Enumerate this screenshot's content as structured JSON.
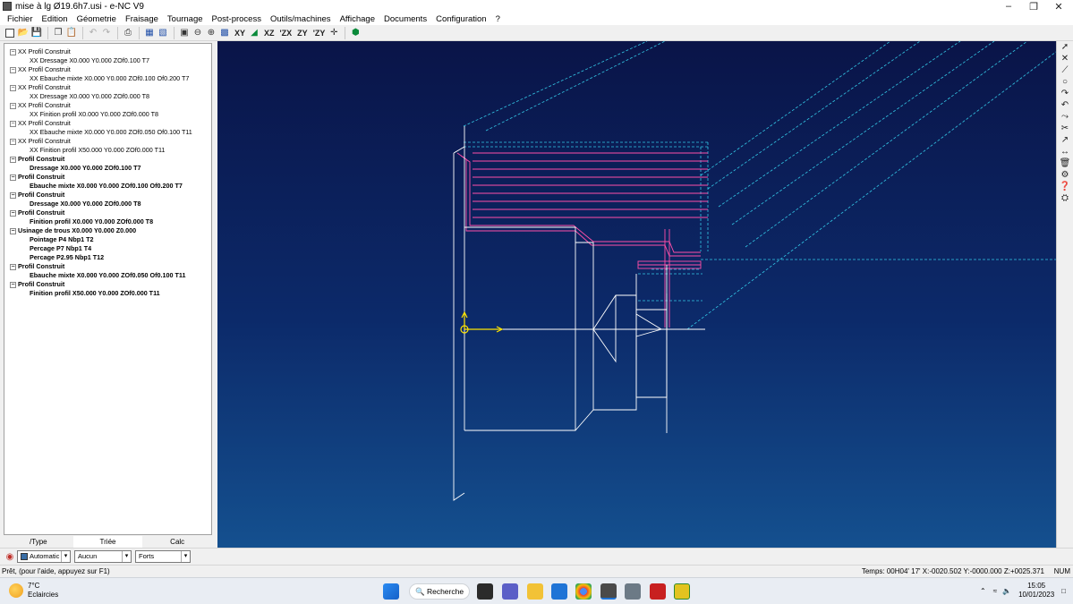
{
  "window": {
    "title": "mise à lg Ø19.6h7.usi - e-NC V9"
  },
  "menu": [
    "Fichier",
    "Edition",
    "Géometrie",
    "Fraisage",
    "Tournage",
    "Post-process",
    "Outils/machines",
    "Affichage",
    "Documents",
    "Configuration",
    "?"
  ],
  "toolbar": {
    "view_labels": [
      "XY",
      "XZ",
      "'ZX",
      "ZY",
      "'ZY"
    ]
  },
  "tree": [
    {
      "label": "XX Profil Construit",
      "level": 0,
      "bold": false
    },
    {
      "label": "XX Dressage X0.000 Y0.000 ZOf0.100 T7",
      "level": 1,
      "bold": false
    },
    {
      "label": "XX Profil Construit",
      "level": 0,
      "bold": false
    },
    {
      "label": "XX Ebauche mixte X0.000 Y0.000 ZOf0.100 Of0.200 T7",
      "level": 1,
      "bold": false
    },
    {
      "label": "XX Profil Construit",
      "level": 0,
      "bold": false
    },
    {
      "label": "XX Dressage X0.000 Y0.000 ZOf0.000 T8",
      "level": 1,
      "bold": false
    },
    {
      "label": "XX Profil Construit",
      "level": 0,
      "bold": false
    },
    {
      "label": "XX Finition profil X0.000 Y0.000 ZOf0.000 T8",
      "level": 1,
      "bold": false
    },
    {
      "label": "XX Profil Construit",
      "level": 0,
      "bold": false
    },
    {
      "label": "XX Ebauche mixte X0.000 Y0.000 ZOf0.050 Of0.100 T11",
      "level": 1,
      "bold": false
    },
    {
      "label": "XX Profil Construit",
      "level": 0,
      "bold": false
    },
    {
      "label": "XX Finition profil X50.000 Y0.000 ZOf0.000 T11",
      "level": 1,
      "bold": false
    },
    {
      "label": "Profil Construit",
      "level": 0,
      "bold": true
    },
    {
      "label": "Dressage X0.000 Y0.000 ZOf0.100 T7",
      "level": 1,
      "bold": true
    },
    {
      "label": "Profil Construit",
      "level": 0,
      "bold": true
    },
    {
      "label": "Ebauche mixte X0.000 Y0.000 ZOf0.100 Of0.200 T7",
      "level": 1,
      "bold": true
    },
    {
      "label": "Profil Construit",
      "level": 0,
      "bold": true
    },
    {
      "label": "Dressage X0.000 Y0.000 ZOf0.000 T8",
      "level": 1,
      "bold": true
    },
    {
      "label": "Profil Construit",
      "level": 0,
      "bold": true
    },
    {
      "label": "Finition profil X0.000 Y0.000 ZOf0.000 T8",
      "level": 1,
      "bold": true
    },
    {
      "label": "Usinage de trous X0.000 Y0.000 Z0.000",
      "level": 0,
      "bold": true
    },
    {
      "label": "Pointage P4 Nbp1 T2",
      "level": 1,
      "bold": true
    },
    {
      "label": "Percage P7 Nbp1 T4",
      "level": 1,
      "bold": true
    },
    {
      "label": "Percage P2.95 Nbp1 T12",
      "level": 1,
      "bold": true
    },
    {
      "label": "Profil Construit",
      "level": 0,
      "bold": true
    },
    {
      "label": "Ebauche mixte X0.000 Y0.000 ZOf0.050 Of0.100 T11",
      "level": 1,
      "bold": true
    },
    {
      "label": "Profil Construit",
      "level": 0,
      "bold": true
    },
    {
      "label": "Finition profil X50.000 Y0.000 ZOf0.000 T11",
      "level": 1,
      "bold": true
    }
  ],
  "tabs": [
    "/Type",
    "Triée",
    "Calc"
  ],
  "options": {
    "color_mode": "Automatic",
    "filter": "Aucun",
    "line_style": "Forts"
  },
  "status": {
    "left": "Prêt, (pour l'aide, appuyez sur F1)",
    "right": "Temps: 00H04' 17'  X:-0020.502 Y:-0000.000 Z:+0025.371",
    "num": "NUM"
  },
  "taskbar": {
    "weather_temp": "7°C",
    "weather_desc": "Eclaircies",
    "search": "Recherche",
    "time": "15:05",
    "date": "10/01/2023"
  },
  "colors": {
    "viewport_top": "#0a1448",
    "viewport_bottom": "#14508f",
    "toolpath_rough": "#ff4fa8",
    "toolpath_rapid": "#33c8e6",
    "part": "#ffffff",
    "origin": "#ffe400"
  }
}
